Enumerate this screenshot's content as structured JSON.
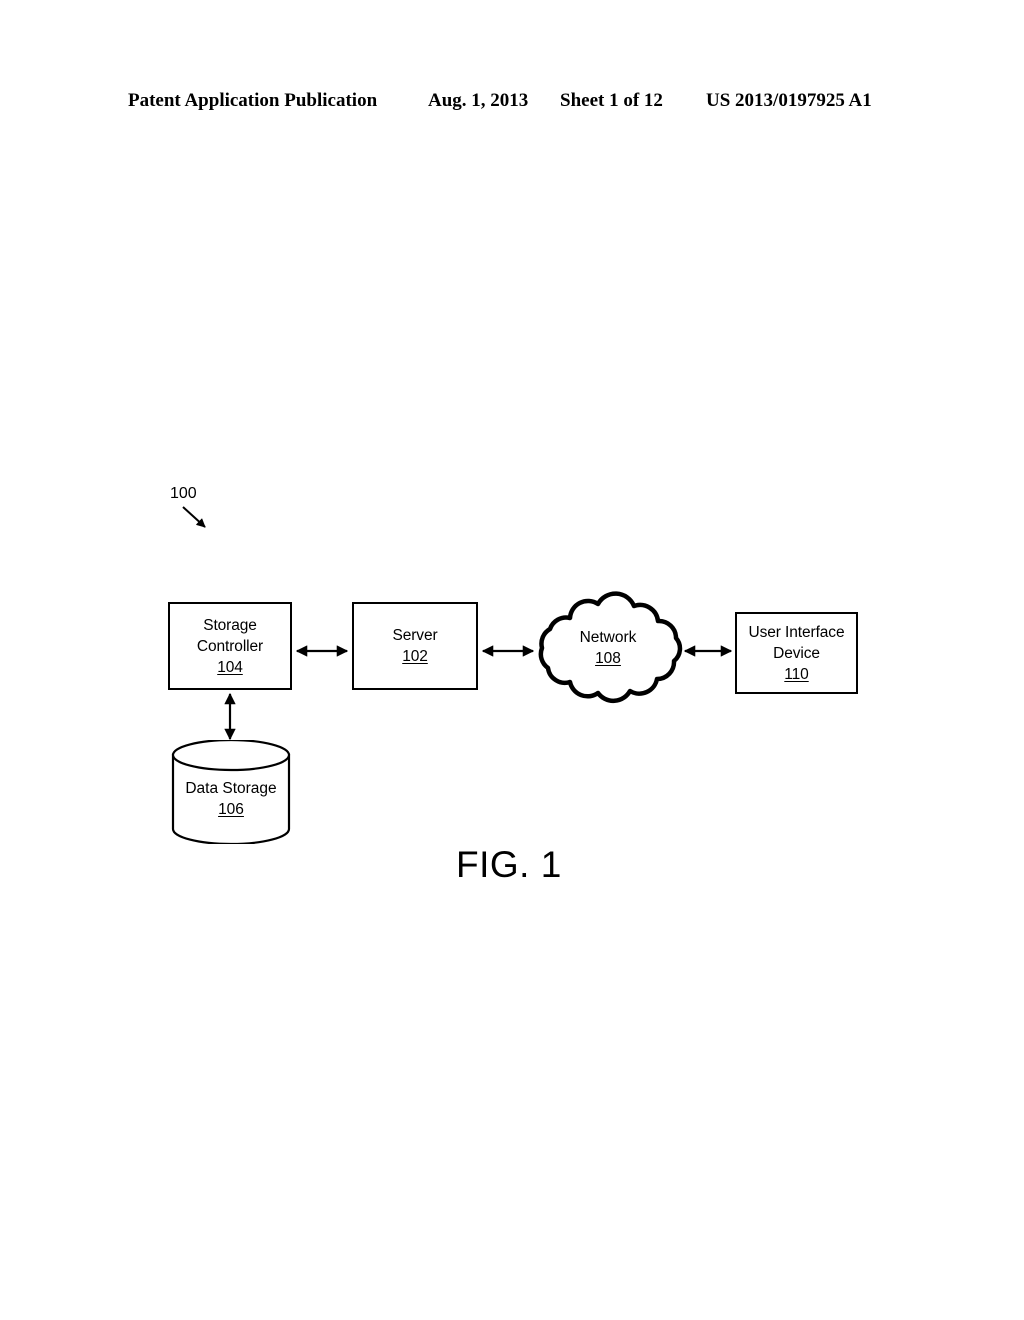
{
  "header": {
    "publication": "Patent Application Publication",
    "date": "Aug. 1, 2013",
    "sheet": "Sheet 1 of 12",
    "patent_number": "US 2013/0197925 A1"
  },
  "figure": {
    "caption": "FIG. 1",
    "system_callout": "100",
    "nodes": {
      "storage_controller": {
        "line1": "Storage",
        "line2": "Controller",
        "ref": "104"
      },
      "server": {
        "line1": "Server",
        "ref": "102"
      },
      "network": {
        "line1": "Network",
        "ref": "108"
      },
      "ui_device": {
        "line1": "User Interface",
        "line2": "Device",
        "ref": "110"
      },
      "data_storage": {
        "line1": "Data Storage",
        "ref": "106"
      }
    }
  },
  "colors": {
    "ink": "#000000",
    "paper": "#ffffff"
  }
}
